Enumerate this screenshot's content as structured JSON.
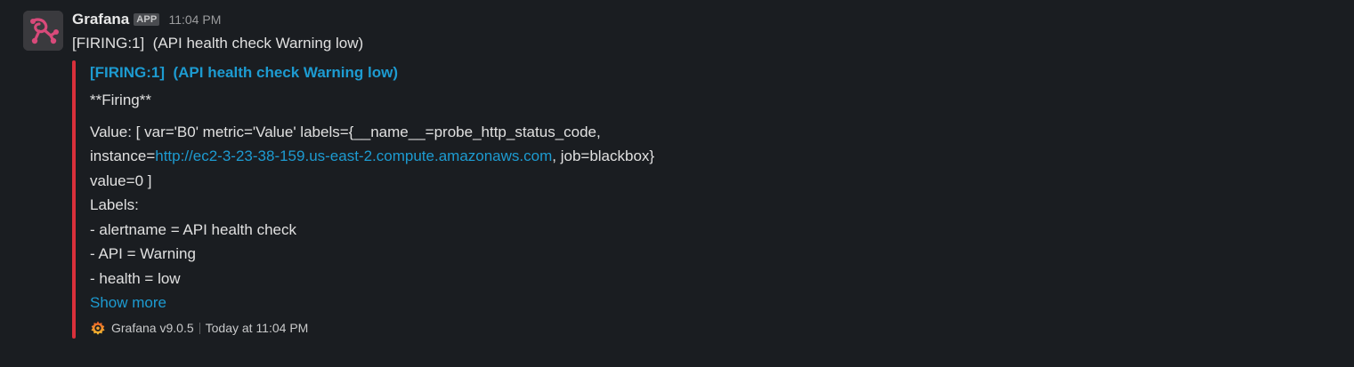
{
  "message": {
    "sender": "Grafana",
    "badge": "APP",
    "time": "11:04 PM",
    "summary": "[FIRING:1]  (API health check Warning low)"
  },
  "attachment": {
    "title": "[FIRING:1]  (API health check Warning low)",
    "firing": "**Firing**",
    "value_line1": "Value: [ var='B0' metric='Value' labels={__name__=probe_http_status_code,",
    "value_line2_prefix": "instance=",
    "value_line2_link": "http://ec2-3-23-38-159.us-east-2.compute.amazonaws.com",
    "value_line2_suffix": ", job=blackbox}",
    "value_line3": "value=0 ]",
    "labels_heading": "Labels:",
    "labels": [
      "- alertname = API health check",
      "- API = Warning",
      "- health = low"
    ],
    "show_more": "Show more",
    "footer_source": "Grafana v9.0.5",
    "footer_time": "Today at 11:04 PM",
    "accent_color": "#d9303b",
    "link_color": "#1d9bd1"
  }
}
